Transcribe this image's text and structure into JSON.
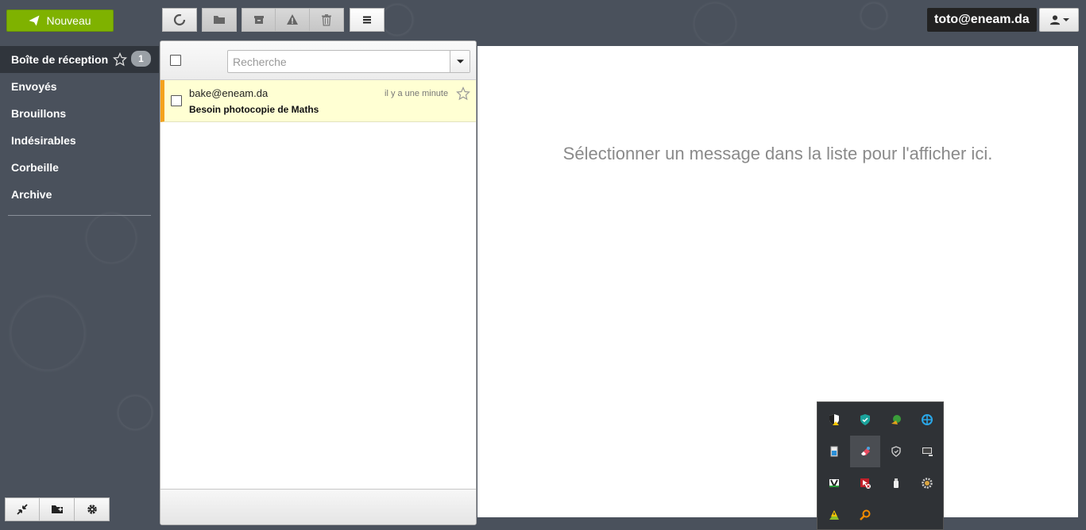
{
  "toolbar": {
    "new_label": "Nouveau"
  },
  "account": {
    "email": "toto@eneam.da"
  },
  "folders": [
    {
      "label": "Boîte de réception",
      "badge": "1"
    },
    {
      "label": "Envoyés"
    },
    {
      "label": "Brouillons"
    },
    {
      "label": "Indésirables"
    },
    {
      "label": "Corbeille"
    },
    {
      "label": "Archive"
    }
  ],
  "search": {
    "placeholder": "Recherche"
  },
  "messages": [
    {
      "from": "bake@eneam.da",
      "date": "il y a une minute",
      "subject": "Besoin photocopie de Maths"
    }
  ],
  "preview": {
    "empty_text": "Sélectionner un message dans la liste pour l'afficher ici."
  },
  "colors": {
    "accent_green": "#7fb200",
    "unread_marker": "#f4a21e",
    "unread_row": "#ffffd3",
    "background": "#4a515c"
  }
}
